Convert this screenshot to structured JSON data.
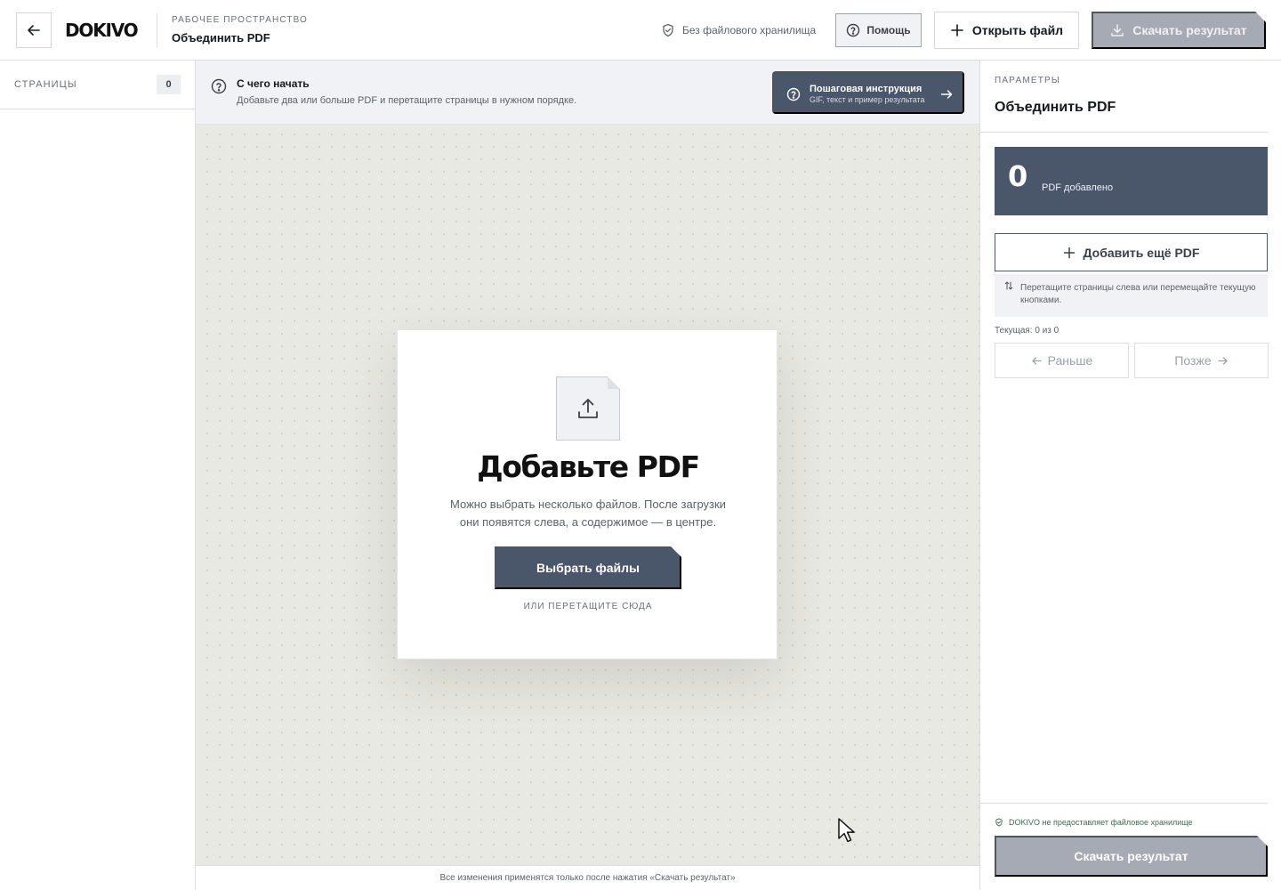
{
  "header": {
    "logo": "DOKIVO",
    "workspace_eyebrow": "РАБОЧЕЕ ПРОСТРАНСТВО",
    "workspace_title": "Объединить PDF",
    "storage_note": "Без файлового хранилища",
    "help_label": "Помощь",
    "open_file_label": "Открыть файл",
    "download_label": "Скачать результат"
  },
  "left_sidebar": {
    "title": "СТРАНИЦЫ",
    "count": "0"
  },
  "intro": {
    "title": "С чего начать",
    "text": "Добавьте два или больше PDF и перетащите страницы в нужном порядке.",
    "guide_title": "Пошаговая инструкция",
    "guide_subtitle": "GIF, текст и пример результата"
  },
  "upload": {
    "title": "Добавьте PDF",
    "description_line1": "Можно выбрать несколько файлов. После загрузки",
    "description_line2": "они появятся слева, а содержимое — в центре.",
    "choose_label": "Выбрать файлы",
    "drop_hint": "ИЛИ ПЕРЕТАЩИТЕ СЮДА"
  },
  "footer": {
    "note": "Все изменения применятся только после нажатия «Скачать результат»"
  },
  "right_sidebar": {
    "eyebrow": "ПАРАМЕТРЫ",
    "title": "Объединить PDF",
    "pdf_count": "0",
    "pdf_count_label": "PDF добавлено",
    "add_more_label": "Добавить ещё PDF",
    "hint": "Перетащите страницы слева или перемещайте текущую кнопками.",
    "current_label": "Текущая: 0 из 0",
    "prev_label": "Раньше",
    "next_label": "Позже",
    "storage_note": "DOKIVO не предоставляет файловое хранилище",
    "download_label": "Скачать результат"
  },
  "icons": {
    "back": "arrow-left-icon",
    "shield": "shield-check-icon",
    "help": "question-circle-icon",
    "plus": "plus-icon",
    "download": "download-icon",
    "upload": "upload-icon",
    "arrow_right": "arrow-right-icon",
    "sort": "sort-arrows-icon",
    "cursor": "mouse-pointer-icon"
  },
  "colors": {
    "accent": "#4a566a",
    "disabled": "#a6aab4",
    "canvas": "#e9e9e3",
    "storage_green": "#3e6b57"
  }
}
